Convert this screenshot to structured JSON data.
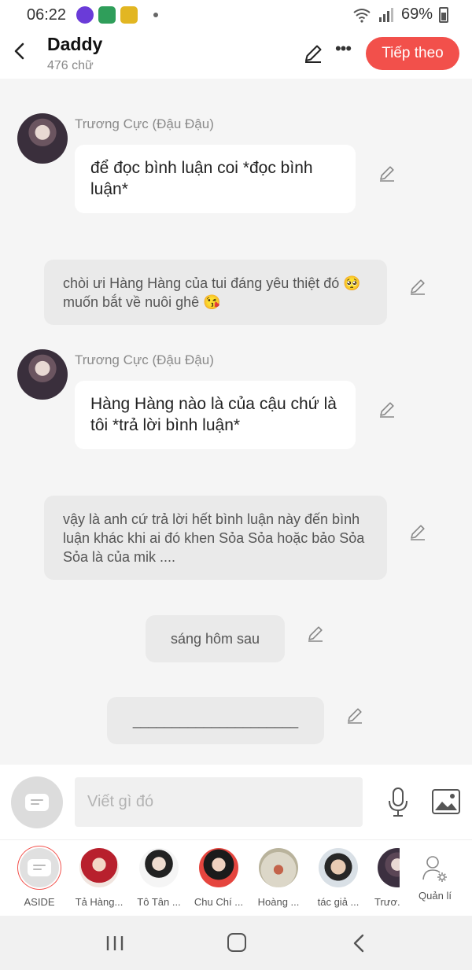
{
  "status_bar": {
    "time": "06:22",
    "battery": "69%"
  },
  "header": {
    "title": "Daddy",
    "subtitle": "476 chữ",
    "next_label": "Tiếp theo"
  },
  "messages": [
    {
      "type": "character",
      "sender": "Trương Cực (Đậu Đậu)",
      "text": "để đọc bình luận coi *đọc bình luận*"
    },
    {
      "type": "narration",
      "text": "chòi ưi Hàng Hàng của tui đáng yêu thiệt đó 🥺 muốn bắt về nuôi ghê 😘"
    },
    {
      "type": "character",
      "sender": "Trương Cực (Đậu Đậu)",
      "text": "Hàng Hàng nào là của cậu chứ là tôi *trả lời bình luận*"
    },
    {
      "type": "narration",
      "text": "vậy là anh cứ trả lời hết bình luận này đến bình luận khác khi ai đó khen Sỏa Sỏa hoặc bảo Sỏa Sỏa là của mik ...."
    },
    {
      "type": "center",
      "text": "sáng hôm sau"
    },
    {
      "type": "center",
      "text": "_____________________"
    }
  ],
  "input": {
    "placeholder": "Viết gì đó"
  },
  "characters": [
    {
      "label": "ASIDE"
    },
    {
      "label": "Tả Hàng..."
    },
    {
      "label": "Tô Tân ..."
    },
    {
      "label": "Chu Chí ..."
    },
    {
      "label": "Hoàng ..."
    },
    {
      "label": "tác giả ..."
    },
    {
      "label": "Trươ..."
    },
    {
      "label": "Quản lí"
    }
  ],
  "colors": {
    "accent": "#f2504b",
    "narration_bg": "#eaeaea",
    "chat_bg": "#f5f5f5"
  },
  "icons": [
    "back-arrow-icon",
    "pencil-icon",
    "more-icon",
    "microphone-icon",
    "image-icon",
    "manage-user-icon",
    "recent-apps-icon",
    "home-icon",
    "back-nav-icon"
  ]
}
